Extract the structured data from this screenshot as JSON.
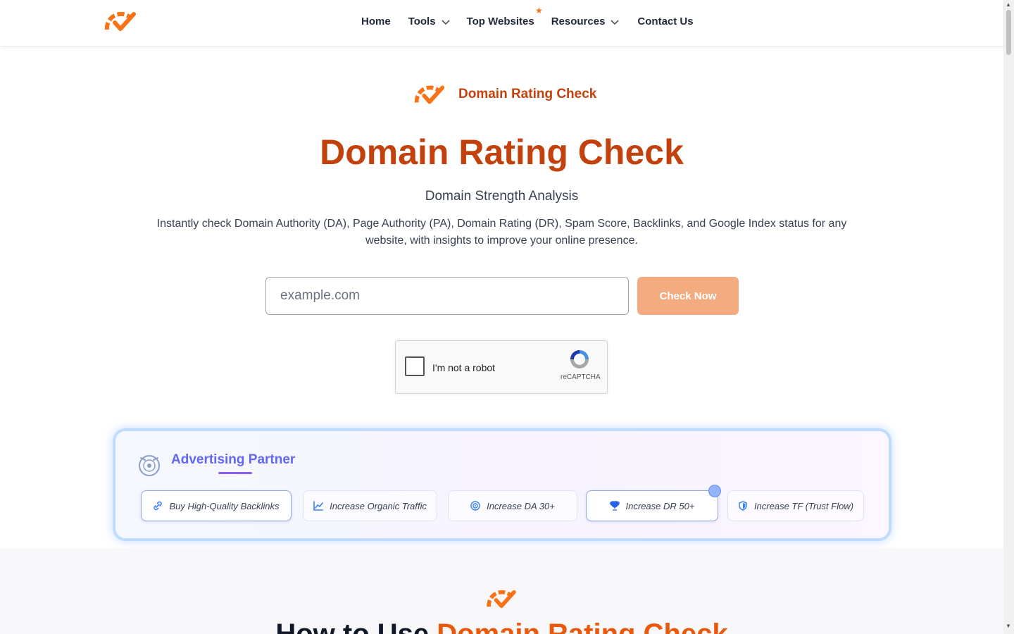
{
  "header": {
    "nav": [
      {
        "label": "Home",
        "has_dropdown": false
      },
      {
        "label": "Tools",
        "has_dropdown": true
      },
      {
        "label": "Top Websites",
        "has_dropdown": false,
        "starred": true
      },
      {
        "label": "Resources",
        "has_dropdown": true
      },
      {
        "label": "Contact Us",
        "has_dropdown": false
      }
    ],
    "star": "★"
  },
  "hero": {
    "badge": "Domain Rating Check",
    "title": "Domain Rating Check",
    "subtitle": "Domain Strength Analysis",
    "description": "Instantly check Domain Authority (DA), Page Authority (PA), Domain Rating (DR), Spam Score, Backlinks, and Google Index status for any website, with insights to improve your online presence.",
    "input_placeholder": "example.com",
    "check_button": "Check Now"
  },
  "captcha": {
    "label": "I'm not a robot",
    "brand": "reCAPTCHA"
  },
  "advertising": {
    "title": "Advertising Partner",
    "chips": [
      {
        "label": "Buy High-Quality Backlinks",
        "icon": "link-icon",
        "active": true
      },
      {
        "label": "Increase Organic Traffic",
        "icon": "chart-icon",
        "active": false
      },
      {
        "label": "Increase DA 30+",
        "icon": "target-icon",
        "active": false
      },
      {
        "label": "Increase DR 50+",
        "icon": "trophy-icon",
        "active": true
      },
      {
        "label": "Increase TF (Trust Flow)",
        "icon": "shield-icon",
        "active": false
      }
    ]
  },
  "how_to": {
    "title_prefix": "How to Use ",
    "title_accent": "Domain Rating Check"
  },
  "colors": {
    "brand_orange": "#f97316",
    "title_orange": "#c2410c",
    "button_orange": "#f3ab7f",
    "partner_purple": "#6366f1"
  }
}
